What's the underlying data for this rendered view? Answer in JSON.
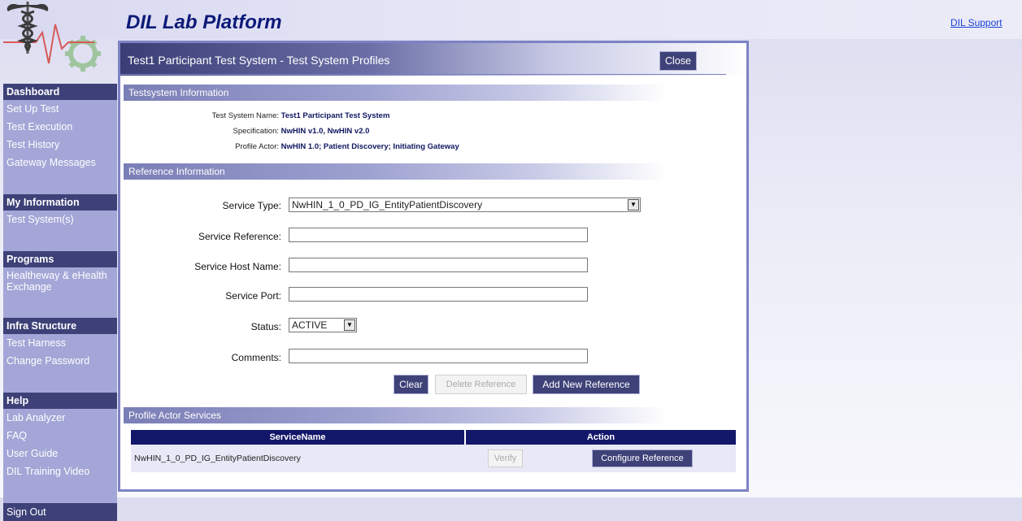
{
  "app": {
    "title": "DIL Lab Platform",
    "support_link": "DIL Support"
  },
  "colors": {
    "accent_dark": "#3d4178",
    "sidebar_item": "#a3a6d6",
    "title_blue": "#0d1a78",
    "table_header": "#13176a"
  },
  "sidebar": {
    "groups": [
      {
        "heading": "Dashboard",
        "items": [
          "Set Up Test",
          "Test Execution",
          "Test History",
          "Gateway Messages"
        ]
      },
      {
        "heading": "My Information",
        "items": [
          "Test System(s)"
        ]
      },
      {
        "heading": "Programs",
        "items": [
          "Healtheway & eHealth Exchange"
        ]
      },
      {
        "heading": "Infra Structure",
        "items": [
          "Test Harness",
          "Change Password"
        ]
      },
      {
        "heading": "Help",
        "items": [
          "Lab Analyzer",
          "FAQ",
          "User Guide",
          "DIL Training Video"
        ]
      }
    ],
    "sign_out": "Sign Out"
  },
  "dialog": {
    "title": "Test1 Participant Test System - Test System Profiles",
    "close_label": "Close",
    "testsystem_section": "Testsystem Information",
    "test_system_name_label": "Test System Name:",
    "test_system_name": "Test1 Participant Test System",
    "specification_label": "Specification:",
    "specification": "NwHIN v1.0, NwHIN v2.0",
    "profile_actor_label": "Profile Actor:",
    "profile_actor": "NwHIN 1.0; Patient Discovery; Initiating Gateway",
    "reference_section": "Reference Information",
    "form": {
      "service_type_label": "Service Type:",
      "service_type_value": "NwHIN_1_0_PD_IG_EntityPatientDiscovery",
      "service_reference_label": "Service Reference:",
      "service_reference_value": "",
      "service_host_label": "Service Host Name:",
      "service_host_value": "",
      "service_port_label": "Service Port:",
      "service_port_value": "",
      "status_label": "Status:",
      "status_value": "ACTIVE",
      "comments_label": "Comments:",
      "comments_value": ""
    },
    "buttons": {
      "clear": "Clear",
      "delete_reference": "Delete Reference",
      "add_new_reference": "Add New Reference"
    },
    "services_section": "Profile Actor Services",
    "table": {
      "headers": [
        "ServiceName",
        "Action"
      ],
      "rows": [
        {
          "service_name": "NwHIN_1_0_PD_IG_EntityPatientDiscovery",
          "verify": "Verify",
          "configure": "Configure Reference"
        }
      ]
    }
  }
}
